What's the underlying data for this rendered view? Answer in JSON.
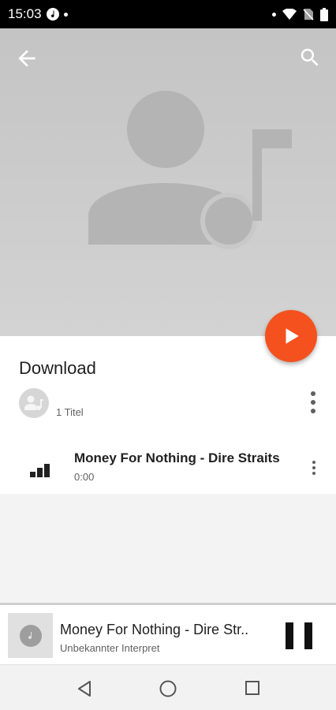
{
  "status_bar": {
    "time": "15:03",
    "icons": [
      "music-note-icon",
      "wifi-icon",
      "no-sim-icon",
      "battery-icon"
    ]
  },
  "header": {
    "back_icon": "arrow-back-icon",
    "search_icon": "search-icon",
    "hero_art": "artist-music-placeholder-icon"
  },
  "playlist": {
    "title": "Download",
    "count": "1 Titel"
  },
  "tracks": [
    {
      "title": "Money For Nothing - Dire Straits",
      "duration": "0:00"
    }
  ],
  "mini_player": {
    "title": "Money For Nothing - Dire Str..",
    "subtitle": "Unbekannter Interpret"
  },
  "colors": {
    "accent": "#f4511e",
    "hero_bg": "#cccccc"
  }
}
